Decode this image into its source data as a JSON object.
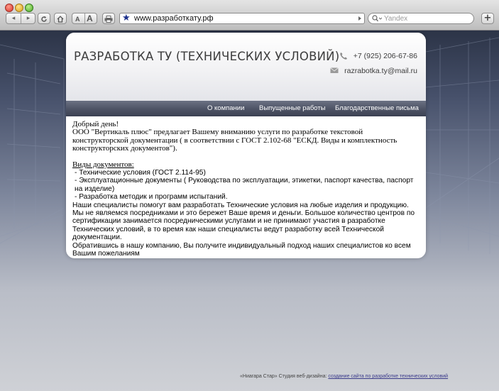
{
  "browser": {
    "url": "www.разработкату.рф",
    "search_placeholder": "Yandex",
    "text_size_small": "A",
    "text_size_large": "A",
    "add_tab_label": "+",
    "back_glyph": "◂",
    "forward_glyph": "▸"
  },
  "site": {
    "title": "РАЗРАБОТКА ТУ (ТЕХНИЧЕСКИХ УСЛОВИЙ)",
    "phone": "+7 (925) 206-67-86",
    "email": "razrabotka.ty@mail.ru"
  },
  "nav": [
    {
      "label": "О компании"
    },
    {
      "label": "Выпущенные работы"
    },
    {
      "label": "Благодарственные письма"
    }
  ],
  "content": {
    "greeting": "Добрый день!",
    "intro": "ООО \"Вертикаль плюс\" предлагает Вашему вниманию услуги по разработке текстовой конструкторской документации ( в соответствии с ГОСТ 2.102-68 \"ЕСКД. Виды и комплектность конструкторских документов\").",
    "doc_types_heading": "Виды документов:",
    "doc_types": [
      "- Технические условия (ГОСТ 2.114-95)",
      "- Эксплуатационные документы ( Руководства по эксплуатации, этикетки, паспорт качества, паспорт на изделие)",
      "- Разработка методик и программ испытаний."
    ],
    "para1": "Наши специалисты помогут вам разработать Технические условия на любые изделия и продукцию.",
    "para2": "Мы не являемся посредниками и это бережет Ваше время и деньги. Большое количество центров по сертификации занимается посредническими услугами и не принимают участия в разработке Технических условий, в то время как наши специалисты ведут разработку всей Технической документации.",
    "para3": "Обратившись в нашу компанию, Вы получите индивидуальный подход наших специалистов ко всем Вашим пожеланиям"
  },
  "footer": {
    "text": "«Ниагара Стар» Студия веб-дизайна: ",
    "link": "создание сайта по разработке технических условий"
  }
}
